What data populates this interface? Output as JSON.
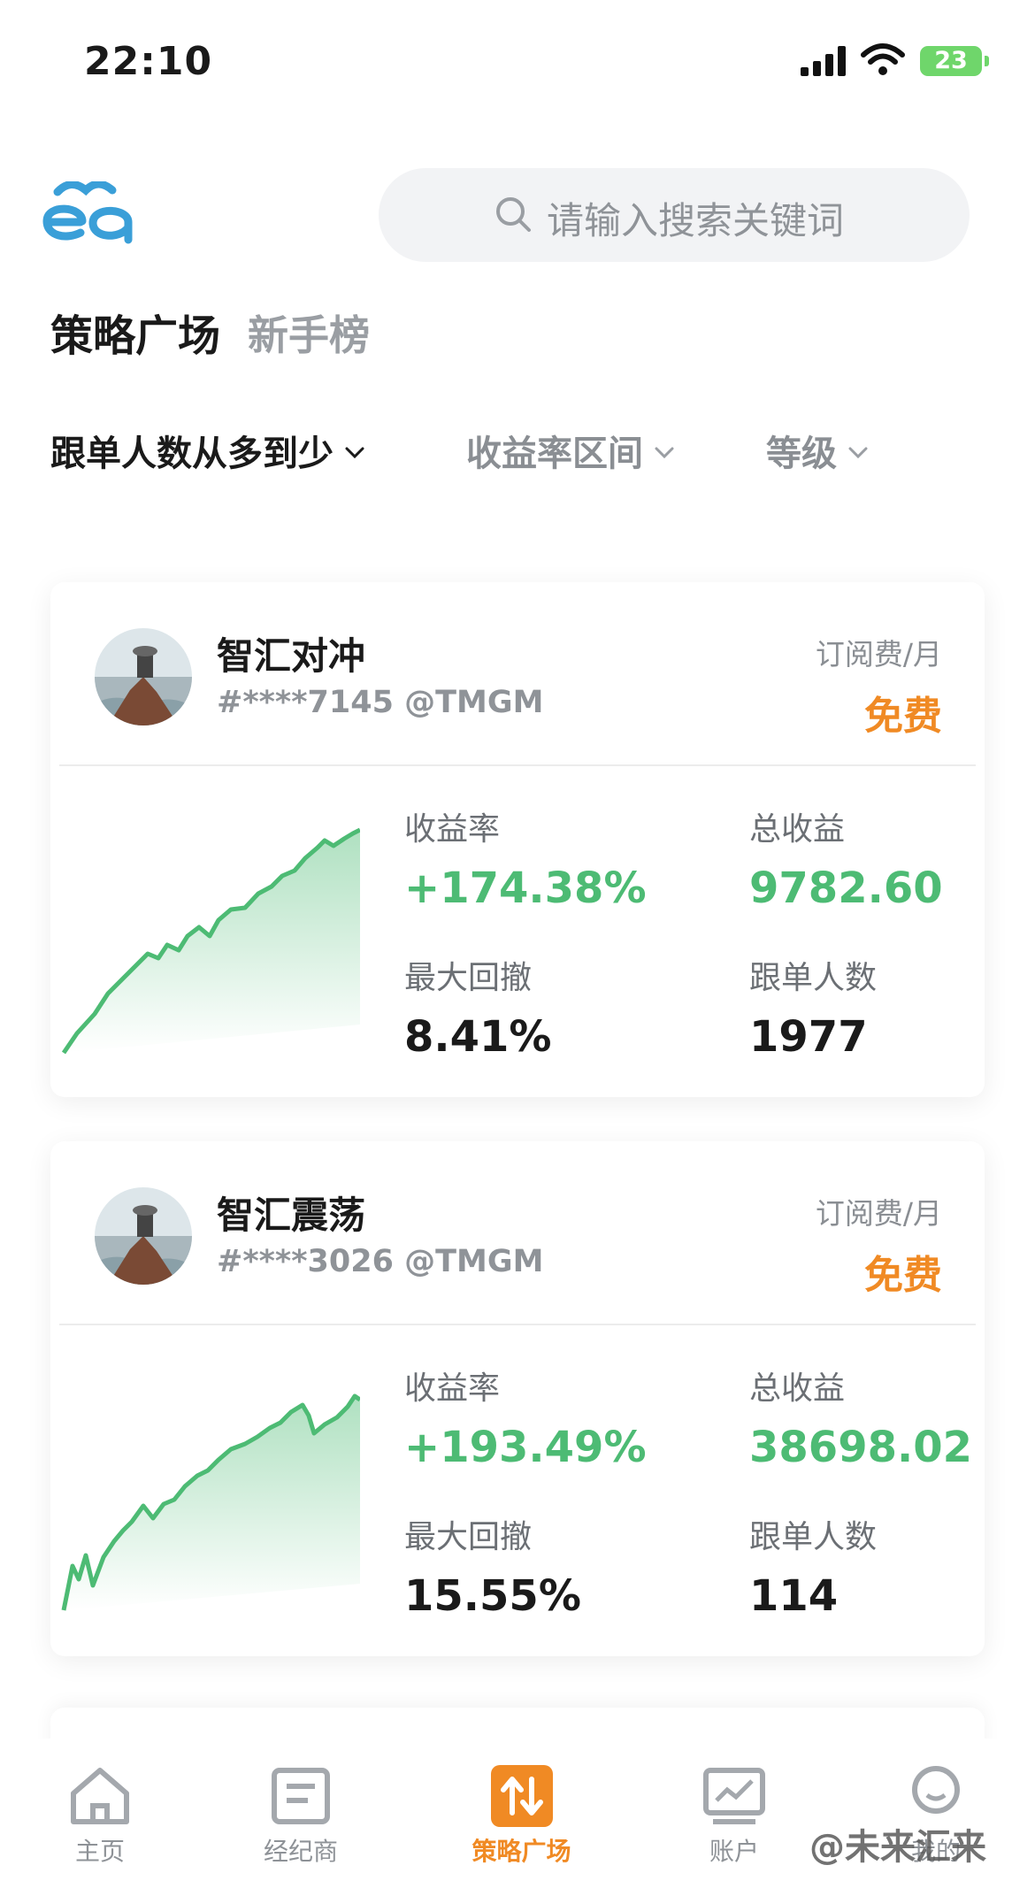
{
  "status": {
    "time": "22:10",
    "battery": "23"
  },
  "search": {
    "placeholder": "请输入搜索关键词"
  },
  "segments": {
    "active": "策略广场",
    "inactive": "新手榜"
  },
  "filters": [
    {
      "label": "跟单人数从多到少"
    },
    {
      "label": "收益率区间"
    },
    {
      "label": "等级"
    }
  ],
  "cards": [
    {
      "name": "智汇对冲",
      "account": "#****7145 @TMGM",
      "fee_label": "订阅费/月",
      "fee": "免费",
      "return_label": "收益率",
      "return_value": "+174.38%",
      "profit_label": "总收益",
      "profit_value": "9782.60",
      "drawdown_label": "最大回撤",
      "drawdown_value": "8.41%",
      "followers_label": "跟单人数",
      "followers_value": "1977"
    },
    {
      "name": "智汇震荡",
      "account": "#****3026 @TMGM",
      "fee_label": "订阅费/月",
      "fee": "免费",
      "return_label": "收益率",
      "return_value": "+193.49%",
      "profit_label": "总收益",
      "profit_value": "38698.02",
      "drawdown_label": "最大回撤",
      "drawdown_value": "15.55%",
      "followers_label": "跟单人数",
      "followers_value": "114"
    }
  ],
  "tabbar": [
    {
      "label": "主页",
      "icon": "home-icon"
    },
    {
      "label": "经纪商",
      "icon": "broker-icon"
    },
    {
      "label": "策略广场",
      "icon": "strategy-icon",
      "active": true
    },
    {
      "label": "账户",
      "icon": "account-chart-icon"
    },
    {
      "label": "我的",
      "icon": "profile-icon"
    }
  ],
  "watermark": "@未来汇来",
  "colors": {
    "accent_orange": "#f08a24",
    "positive_green": "#4dbb74",
    "brand_blue": "#3a9fd8"
  }
}
